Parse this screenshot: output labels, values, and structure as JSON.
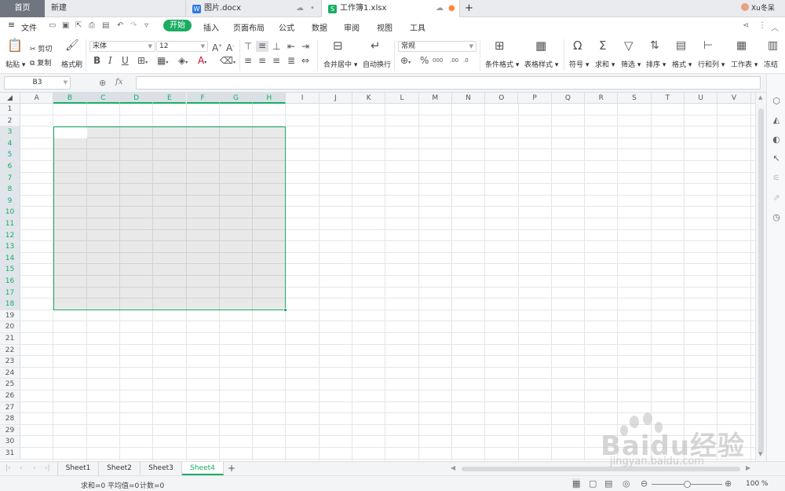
{
  "tabs": {
    "home": "首页",
    "new": "新建",
    "doc": "图片.docx",
    "xls": "工作簿1.xlsx",
    "plus": "+",
    "user": "Xu冬呆"
  },
  "menu": {
    "file": "文件",
    "items": [
      "开始",
      "插入",
      "页面布局",
      "公式",
      "数据",
      "审阅",
      "视图",
      "工具"
    ]
  },
  "ribbon": {
    "paste": "粘贴",
    "cut": "剪切",
    "copy": "复制",
    "format_painter": "格式刷",
    "font_name": "宋体",
    "font_size": "12",
    "bold": "B",
    "italic": "I",
    "underline": "U",
    "merge_center": "合并居中",
    "auto_wrap": "自动换行",
    "number_format": "常规",
    "percent": "%",
    "cond_format": "条件格式",
    "table_style": "表格样式",
    "symbol": "符号",
    "sum": "求和",
    "filter": "筛选",
    "sort": "排序",
    "format": "格式",
    "row_col": "行和列",
    "worksheet": "工作表",
    "freeze": "冻结"
  },
  "formula_bar": {
    "name_box": "B3",
    "fx": "fx",
    "value": ""
  },
  "grid": {
    "columns": [
      "A",
      "B",
      "C",
      "D",
      "E",
      "F",
      "G",
      "H",
      "I",
      "J",
      "K",
      "L",
      "M",
      "N",
      "O",
      "P",
      "Q",
      "R",
      "S",
      "T",
      "U",
      "V"
    ],
    "rows": [
      "1",
      "2",
      "3",
      "4",
      "5",
      "6",
      "7",
      "8",
      "9",
      "10",
      "11",
      "12",
      "13",
      "14",
      "15",
      "16",
      "17",
      "18",
      "19",
      "20",
      "21",
      "22",
      "23",
      "24",
      "25",
      "26",
      "27",
      "28",
      "29",
      "30",
      "31"
    ],
    "selection": "B3:H18",
    "active_cell": "B3"
  },
  "sheets": [
    "Sheet1",
    "Sheet2",
    "Sheet3",
    "Sheet4"
  ],
  "active_sheet": "Sheet4",
  "status": {
    "sum": "求和=0",
    "avg": "平均值=0",
    "count": "计数=0",
    "zoom": "100 %"
  },
  "watermark": {
    "brand": "Baidu经验",
    "url": "jingyan.baidu.com"
  },
  "colors": {
    "accent": "#1aad62",
    "doc_icon": "#2b79e6",
    "xls_icon": "#1aad62"
  }
}
